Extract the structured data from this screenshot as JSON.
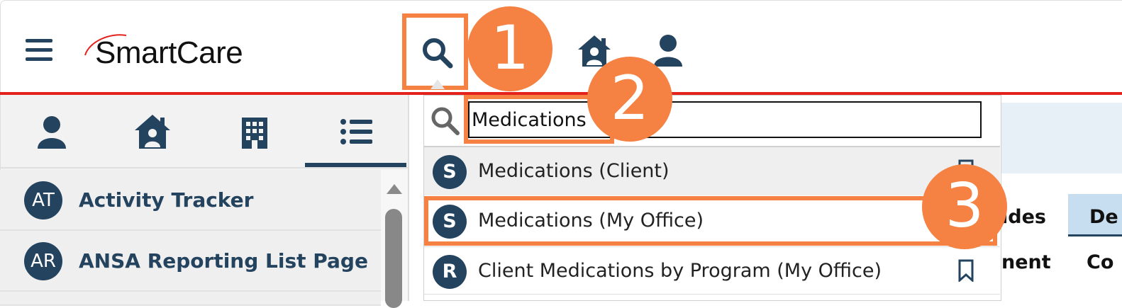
{
  "header": {
    "app_name": "SmartCare",
    "icons": [
      "menu-icon",
      "search-icon",
      "home-icon",
      "user-icon"
    ]
  },
  "left_tabs": [
    "client-icon",
    "home-icon",
    "building-icon",
    "list-icon"
  ],
  "left_list": {
    "items": [
      {
        "initials": "AT",
        "label": "Activity Tracker"
      },
      {
        "initials": "AR",
        "label": "ANSA Reporting List Page"
      }
    ]
  },
  "search": {
    "value": "Medications",
    "results": [
      {
        "badge": "S",
        "label": "Medications (Client)"
      },
      {
        "badge": "S",
        "label": "Medications (My Office)"
      },
      {
        "badge": "R",
        "label": "Client Medications by Program (My Office)"
      }
    ]
  },
  "background": {
    "tab_fragment_1": "ides",
    "tab_fragment_2": "De",
    "col_fragment_1": "nent",
    "col_fragment_2": "Co"
  },
  "callouts": [
    "1",
    "2",
    "3"
  ],
  "colors": {
    "brand_navy": "#24435f",
    "accent_red": "#e4211b",
    "callout_orange": "#f58142"
  }
}
